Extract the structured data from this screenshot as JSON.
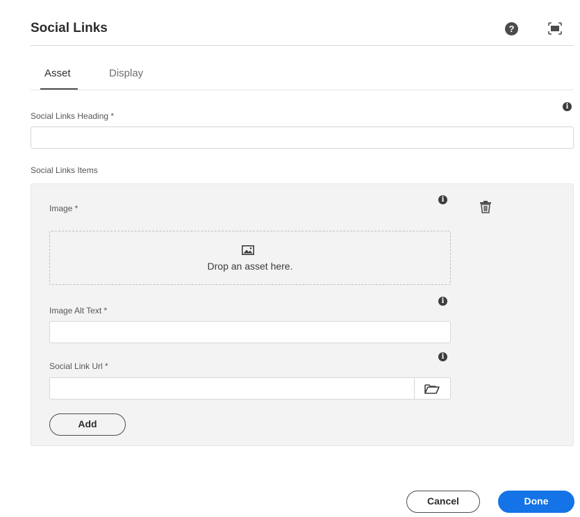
{
  "dialog": {
    "title": "Social Links",
    "help_icon": "help-circle-icon",
    "fullscreen_icon": "fullscreen-icon"
  },
  "tabs": [
    {
      "label": "Asset",
      "active": true
    },
    {
      "label": "Display",
      "active": false
    }
  ],
  "heading_field": {
    "label": "Social Links Heading *",
    "value": ""
  },
  "items_section": {
    "label": "Social Links Items",
    "image_field": {
      "label": "Image *"
    },
    "dropzone": {
      "text": "Drop an asset here.",
      "icon": "image-icon"
    },
    "alt_text_field": {
      "label": "Image Alt Text *",
      "value": ""
    },
    "url_field": {
      "label": "Social Link Url *",
      "value": "",
      "browse_icon": "folder-icon"
    },
    "delete_icon": "trash-icon",
    "add_label": "Add"
  },
  "footer": {
    "cancel_label": "Cancel",
    "done_label": "Done"
  },
  "colors": {
    "accent": "#1473e6",
    "panel_bg": "#f3f3f3",
    "text": "#2c2c2c"
  }
}
